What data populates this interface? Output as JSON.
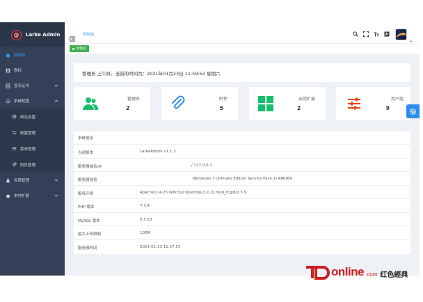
{
  "brand": {
    "title": "Larke Admin"
  },
  "sidebar": {
    "items": [
      {
        "label": "控制台",
        "icon": "home-icon",
        "active": true
      },
      {
        "label": "图标",
        "icon": "grid-icon"
      },
      {
        "label": "签名证书",
        "icon": "certificate-icon",
        "caret": true
      },
      {
        "label": "系统配置",
        "icon": "gear-icon",
        "caret": true,
        "open": true
      },
      {
        "label": "网站设置",
        "icon": "settings-icon",
        "sub": true
      },
      {
        "label": "配置管理",
        "icon": "sliders-icon",
        "sub": true
      },
      {
        "label": "菜单管理",
        "icon": "list-icon",
        "sub": true
      },
      {
        "label": "附件管理",
        "icon": "paperclip-icon",
        "sub": true
      },
      {
        "label": "权限管理",
        "icon": "lock-icon",
        "caret": true
      },
      {
        "label": "本地扩展",
        "icon": "puzzle-icon",
        "caret": true
      }
    ]
  },
  "header": {
    "breadcrumb": "控制台"
  },
  "tabs": [
    {
      "label": "控制台"
    }
  ],
  "greeting": "管理员 上午好，当前的时间为：2021年01月23日 11:59:52 星期六",
  "cards": [
    {
      "title": "管理员",
      "value": "2",
      "icon": "users-icon",
      "color": "#19be6b"
    },
    {
      "title": "附件",
      "value": "5",
      "icon": "paperclip-icon",
      "color": "#2d8cf0"
    },
    {
      "title": "启用扩展",
      "value": "2",
      "icon": "apps-icon",
      "color": "#19be6b"
    },
    {
      "title": "用户组",
      "value": "9",
      "icon": "sliders-icon",
      "color": "#ed4014"
    }
  ],
  "system_info": {
    "title": "系统信息",
    "rows": [
      {
        "key": "当前版本",
        "value": "LarkeAdmin v1.1.3"
      },
      {
        "key": "服务器域名/IP",
        "value": "/ 127.0.0.1"
      },
      {
        "key": "服务器信息",
        "value": "(Windows 7 Ultimate Edition Service Pack 1) AMD64"
      },
      {
        "key": "服务环境",
        "value": "Apache/2.4.23 (Win32) OpenSSL/1.0.2j mod_fcgid/2.3.9"
      },
      {
        "key": "PHP 版本",
        "value": "7.3.4"
      },
      {
        "key": "MySQL 版本",
        "value": "5.5.53"
      },
      {
        "key": "最大上传限制",
        "value": "100M"
      },
      {
        "key": "服务器时间",
        "value": "2021-01-23 11:57:53"
      }
    ]
  },
  "watermark": {
    "text": "online",
    "suffix": ".com",
    "cn": "红色經典"
  },
  "colors": {
    "sidebar": "#344058",
    "accent": "#3aa0ff",
    "tab": "#3fb14d",
    "background": "#eef1f5"
  }
}
